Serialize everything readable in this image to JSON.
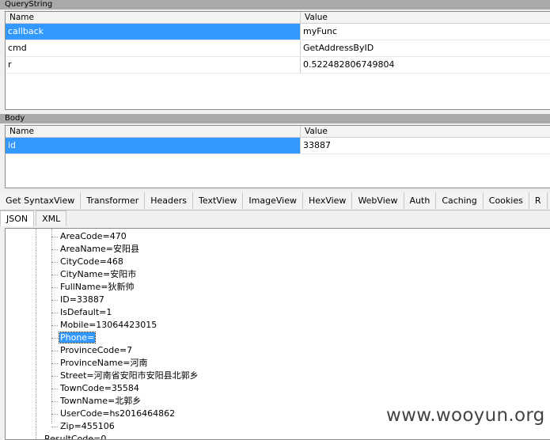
{
  "querystring": {
    "title": "QueryString",
    "headers": [
      "Name",
      "Value"
    ],
    "rows": [
      {
        "name": "callback",
        "value": "myFunc"
      },
      {
        "name": "cmd",
        "value": "GetAddressByID"
      },
      {
        "name": "r",
        "value": "0.522482806749804"
      }
    ]
  },
  "body": {
    "title": "Body",
    "headers": [
      "Name",
      "Value"
    ],
    "rows": [
      {
        "name": "id",
        "value": "33887"
      }
    ]
  },
  "tabs": [
    "Get SyntaxView",
    "Transformer",
    "Headers",
    "TextView",
    "ImageView",
    "HexView",
    "WebView",
    "Auth",
    "Caching",
    "Cookies",
    "R"
  ],
  "subtabs": [
    "JSON",
    "XML"
  ],
  "tree": {
    "nodes": [
      "AreaCode=470",
      "AreaName=安阳县",
      "CityCode=468",
      "CityName=安阳市",
      "FullName=狄新帅",
      "ID=33887",
      "IsDefault=1",
      "Mobile=13064423015",
      "Phone=",
      "ProvinceCode=7",
      "ProvinceName=河南",
      "Street=河南省安阳市安阳县北郭乡",
      "TownCode=35584",
      "TownName=北郭乡",
      "UserCode=hs2016464862",
      "Zip=455106"
    ],
    "outer_node": "ResultCode=0"
  },
  "watermark": "www.wooyun.org",
  "colors": {
    "selection": "#3399ff",
    "section_bar": "#a9a9a9"
  }
}
